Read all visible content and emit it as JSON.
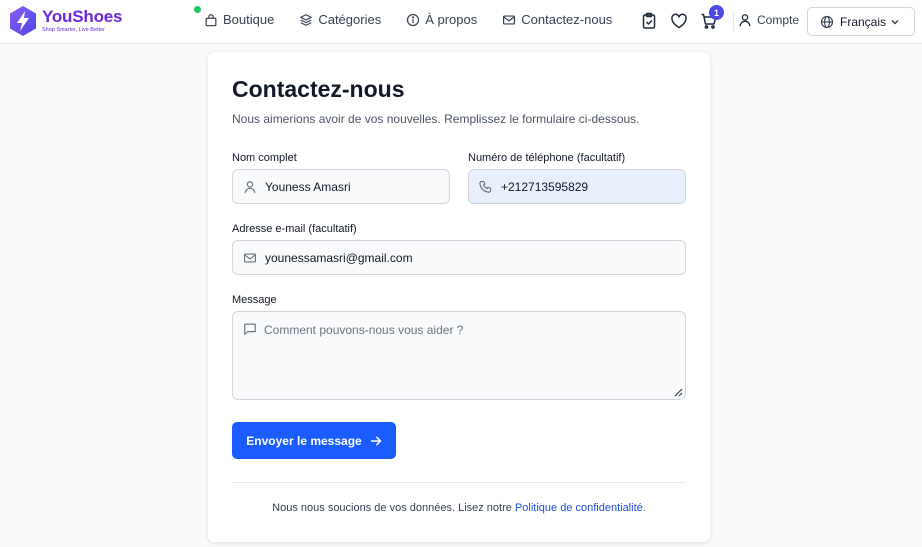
{
  "header": {
    "brand_name": "YouShoes",
    "brand_tagline": "Shop Smarter, Live Better",
    "nav": [
      {
        "label": "Boutique",
        "icon": "bag-icon"
      },
      {
        "label": "Catégories",
        "icon": "layers-icon"
      },
      {
        "label": "À propos",
        "icon": "info-icon"
      },
      {
        "label": "Contactez-nous",
        "icon": "mail-icon"
      }
    ],
    "cart_count": "1",
    "account_label": "Compte",
    "language": "Français"
  },
  "form": {
    "title": "Contactez-nous",
    "subtitle": "Nous aimerions avoir de vos nouvelles. Remplissez le formulaire ci-dessous.",
    "name_label": "Nom complet",
    "name_value": "Youness Amasri",
    "phone_label": "Numéro de téléphone (facultatif)",
    "phone_value": "+212713595829",
    "email_label": "Adresse e-mail (facultatif)",
    "email_value": "younessamasri@gmail.com",
    "message_label": "Message",
    "message_placeholder": "Comment pouvons-nous vous aider ?",
    "submit_label": "Envoyer le message",
    "privacy_prefix": "Nous nous soucions de vos données. Lisez notre ",
    "privacy_link": "Politique de confidentialité",
    "privacy_suffix": "."
  },
  "colors": {
    "brand": "#6d28d9",
    "primary_button": "#1a5cff",
    "badge": "#4f46e5",
    "status_online": "#22c55e"
  }
}
